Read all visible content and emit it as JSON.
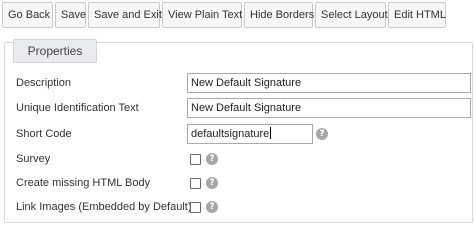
{
  "toolbar": {
    "buttons": [
      {
        "label": "Go Back"
      },
      {
        "label": "Save"
      },
      {
        "label": "Save and Exit"
      },
      {
        "label": "View Plain Text"
      },
      {
        "label": "Hide Borders"
      },
      {
        "label": "Select Layout"
      },
      {
        "label": "Edit HTML"
      }
    ]
  },
  "panel": {
    "legend": "Properties",
    "fields": {
      "description": {
        "label": "Description",
        "value": "New Default Signature"
      },
      "unique_id": {
        "label": "Unique Identification Text",
        "value": "New Default Signature"
      },
      "short_code": {
        "label": "Short Code",
        "value": "defaultsignature",
        "help_icon": "question-circle-icon"
      },
      "survey": {
        "label": "Survey",
        "checked": false,
        "help_icon": "question-circle-icon"
      },
      "create_missing_html_body": {
        "label": "Create missing HTML Body",
        "checked": false,
        "help_icon": "question-circle-icon"
      },
      "link_images": {
        "label": "Link Images (Embedded by Default)",
        "checked": false,
        "help_icon": "question-circle-icon"
      }
    }
  },
  "icons": {
    "help_glyph": "?"
  },
  "colors": {
    "legend_background": "#e9ebee",
    "help_icon": "#a6a6a6",
    "button_background": "#f7f7f7"
  }
}
